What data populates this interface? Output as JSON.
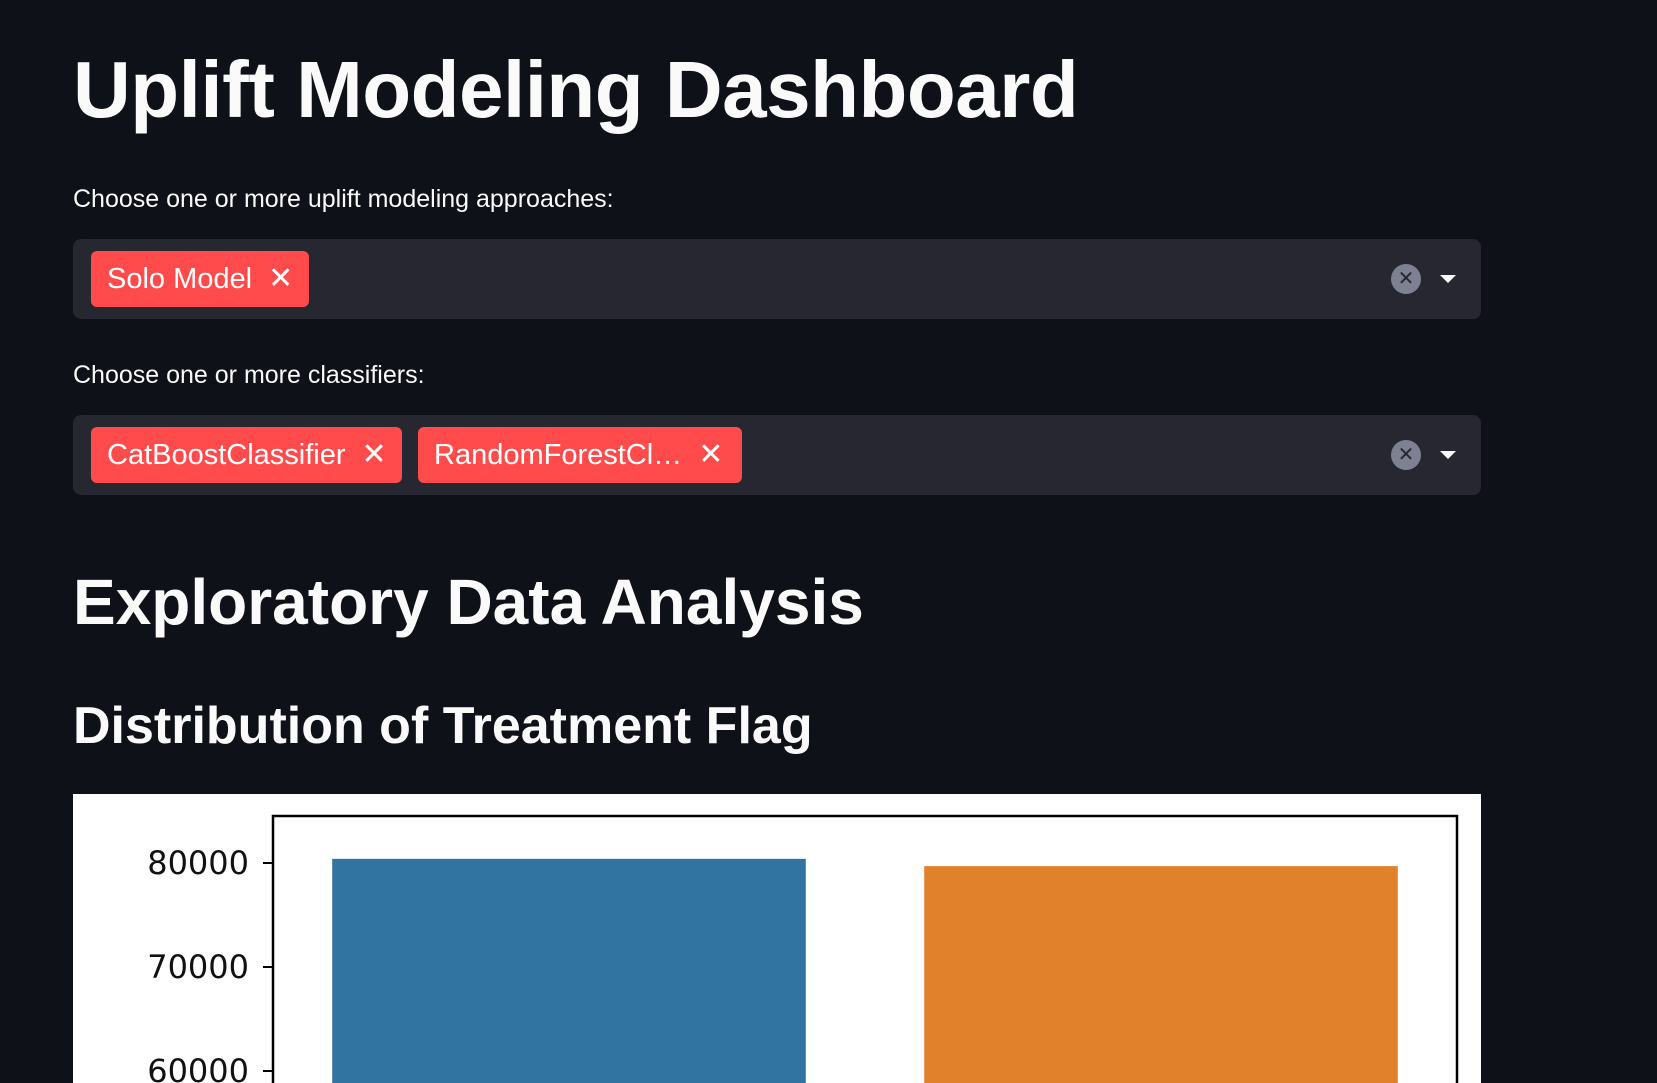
{
  "page": {
    "title": "Uplift Modeling Dashboard"
  },
  "approach_select": {
    "label": "Choose one or more uplift modeling approaches:",
    "selected": [
      "Solo Model"
    ],
    "clear_icon": "close-circle-icon",
    "dropdown_icon": "chevron-down-icon"
  },
  "classifier_select": {
    "label": "Choose one or more classifiers:",
    "selected": [
      "CatBoostClassifier",
      "RandomForestCl…"
    ],
    "clear_icon": "close-circle-icon",
    "dropdown_icon": "chevron-down-icon"
  },
  "eda": {
    "heading": "Exploratory Data Analysis",
    "subheading": "Distribution of Treatment Flag"
  },
  "colors": {
    "background": "#0e1117",
    "tag": "#ff4b4b",
    "select_bg": "#262730",
    "bar_blue": "#3274a1",
    "bar_orange": "#e1812c"
  },
  "chart_data": {
    "type": "bar",
    "categories": [
      "",
      ""
    ],
    "values": [
      80400,
      79700
    ],
    "bar_colors": [
      "#3274a1",
      "#e1812c"
    ],
    "yticks": [
      60000,
      70000,
      80000
    ],
    "ytick_labels": [
      "60000",
      "70000",
      "80000"
    ],
    "ylim_visible": [
      58500,
      86000
    ],
    "title": "",
    "xlabel": "",
    "ylabel": ""
  }
}
